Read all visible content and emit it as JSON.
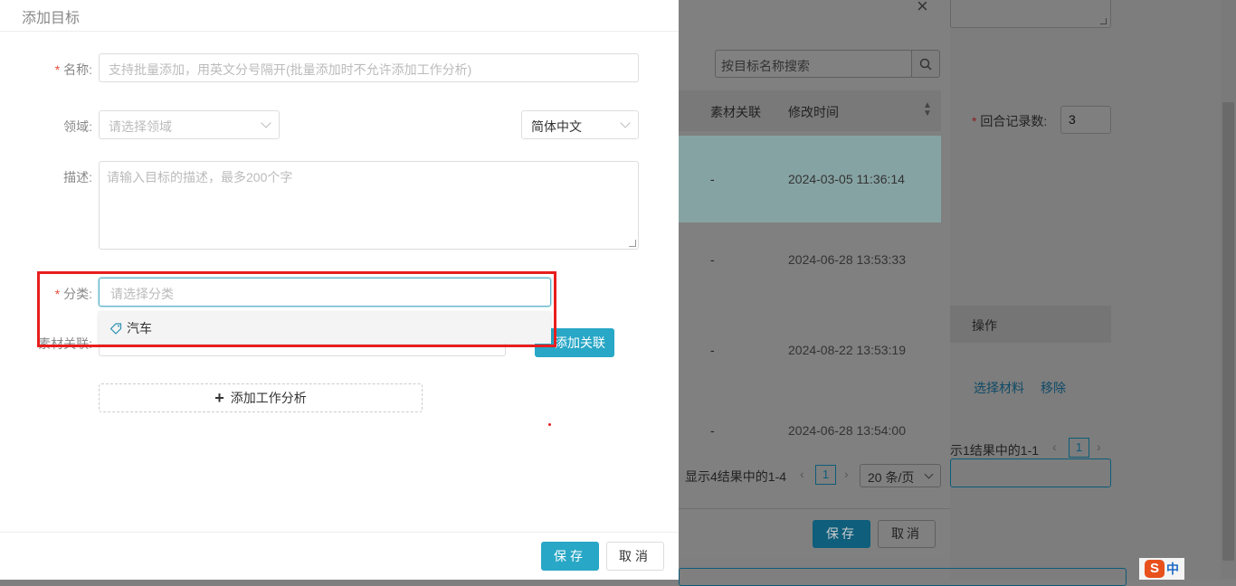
{
  "drawer": {
    "title": "添加目标",
    "name": {
      "label": "名称:",
      "placeholder": "支持批量添加，用英文分号隔开(批量添加时不允许添加工作分析)"
    },
    "domain": {
      "label": "领域:",
      "placeholder": "请选择领域"
    },
    "language": {
      "value": "简体中文"
    },
    "description": {
      "label": "描述:",
      "placeholder": "请输入目标的描述，最多200个字"
    },
    "category": {
      "label": "分类:",
      "placeholder": "请选择分类",
      "options": [
        "汽车"
      ]
    },
    "material": {
      "label": "素材关联:",
      "add_button": "添加关联"
    },
    "add_analysis": "添加工作分析",
    "save": "保存",
    "cancel": "取消"
  },
  "middle_dialog": {
    "close": "×",
    "search_placeholder": "按目标名称搜索",
    "columns": [
      "素材关联",
      "修改时间"
    ],
    "rows": [
      {
        "material": "-",
        "time": "2024-03-05 11:36:14"
      },
      {
        "material": "-",
        "time": "2024-06-28 13:53:33"
      },
      {
        "material": "-",
        "time": "2024-08-22 13:53:19"
      },
      {
        "material": "-",
        "time": "2024-06-28 13:54:00"
      }
    ],
    "pagination_text": "显示4结果中的1-4",
    "page": "1",
    "page_size": "20 条/页",
    "save": "保存",
    "cancel": "取消"
  },
  "background_page": {
    "record_label": "回合记录数:",
    "record_value": "3",
    "operation_header": "操作",
    "link_select": "选择材料",
    "link_remove": "移除",
    "pagination_text": "示1结果中的1-1",
    "page": "1"
  },
  "ime": {
    "label": "中"
  },
  "colors": {
    "accent": "#28a7c6",
    "highlight_box": "#e81e1e",
    "required": "#e74c3c"
  }
}
